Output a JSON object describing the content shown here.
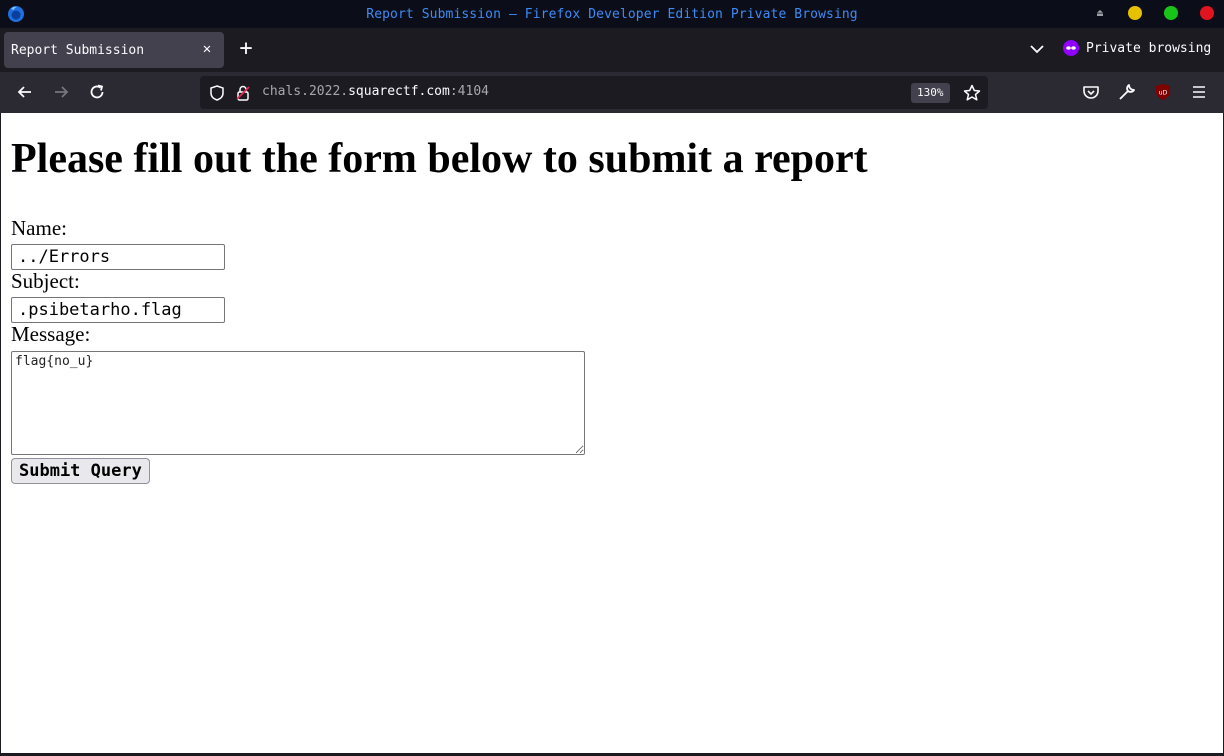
{
  "window": {
    "title": "Report Submission — Firefox Developer Edition Private Browsing",
    "controls_colors": {
      "minimize": "#e5c100",
      "maximize": "#18c418",
      "close": "#e0141e"
    }
  },
  "tabs": [
    {
      "label": "Report Submission",
      "active": true
    }
  ],
  "tabstrip": {
    "new_tab_icon": "plus-icon",
    "private_label": "Private browsing"
  },
  "navbar": {
    "url_prefix": "chals.2022.",
    "url_host": "squarectf.com",
    "url_port": ":4104",
    "zoom": "130%"
  },
  "page": {
    "heading": "Please fill out the form below to submit a report",
    "name_label": "Name:",
    "name_value": "../Errors",
    "subject_label": "Subject:",
    "subject_value": ".psibetarho.flag",
    "message_label": "Message:",
    "message_value": "flag{no_u}",
    "submit_label": "Submit Query"
  },
  "colors": {
    "title_text": "#3d8bf5",
    "private_accent": "#8f00ff",
    "ublock_red": "#800000"
  }
}
